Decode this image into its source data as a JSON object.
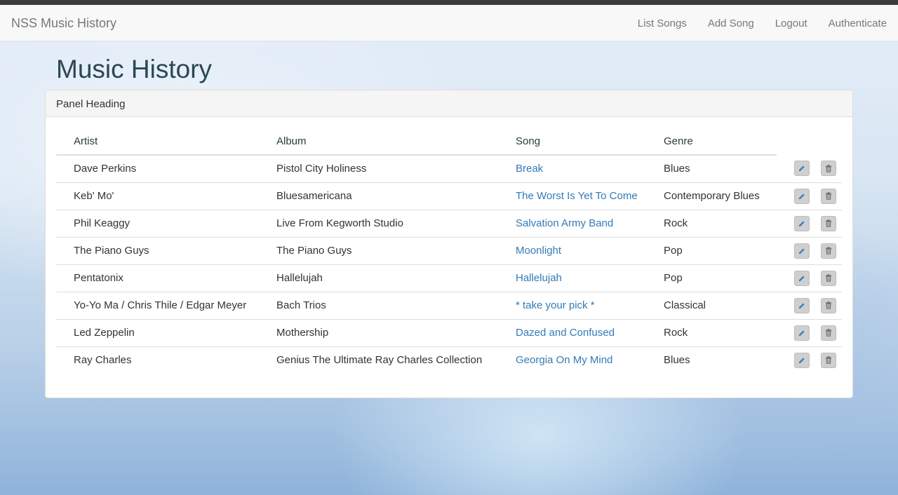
{
  "navbar": {
    "brand": "NSS Music History",
    "links": [
      "List Songs",
      "Add Song",
      "Logout",
      "Authenticate"
    ]
  },
  "page": {
    "title": "Music History"
  },
  "panel": {
    "heading": "Panel Heading",
    "columns": [
      "Artist",
      "Album",
      "Song",
      "Genre"
    ],
    "rows": [
      {
        "artist": "Dave Perkins",
        "album": "Pistol City Holiness",
        "song": "Break",
        "genre": "Blues"
      },
      {
        "artist": "Keb' Mo'",
        "album": "Bluesamericana",
        "song": "The Worst Is Yet To Come",
        "genre": "Contemporary Blues"
      },
      {
        "artist": "Phil Keaggy",
        "album": "Live From Kegworth Studio",
        "song": "Salvation Army Band",
        "genre": "Rock"
      },
      {
        "artist": "The Piano Guys",
        "album": "The Piano Guys",
        "song": "Moonlight",
        "genre": "Pop"
      },
      {
        "artist": "Pentatonix",
        "album": "Hallelujah",
        "song": "Hallelujah",
        "genre": "Pop"
      },
      {
        "artist": "Yo-Yo Ma / Chris Thile / Edgar Meyer",
        "album": "Bach Trios",
        "song": "* take your pick *",
        "genre": "Classical"
      },
      {
        "artist": "Led Zeppelin",
        "album": "Mothership",
        "song": "Dazed and Confused",
        "genre": "Rock"
      },
      {
        "artist": "Ray Charles",
        "album": "Genius The Ultimate Ray Charles Collection",
        "song": "Georgia On My Mind",
        "genre": "Blues"
      }
    ],
    "icons": {
      "edit": "pencil-icon",
      "delete": "trash-icon"
    }
  },
  "colors": {
    "link": "#337ab7",
    "title": "#2b4753",
    "navText": "#777777"
  }
}
